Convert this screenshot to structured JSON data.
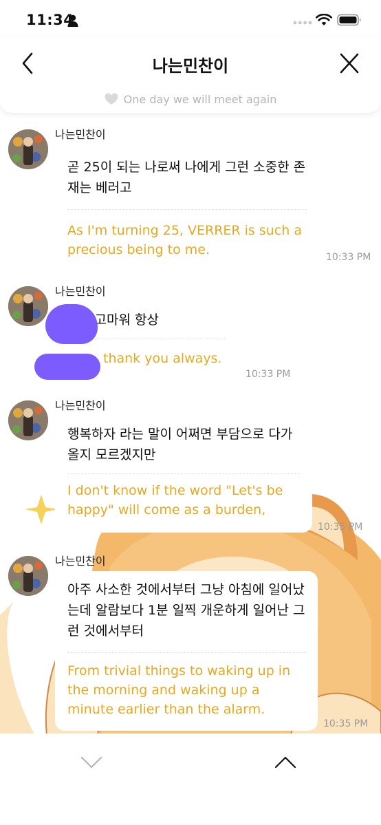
{
  "status_bar": {
    "time": "11:34"
  },
  "header": {
    "title": "나는민찬이",
    "subtitle": "One day we will meet again"
  },
  "messages": [
    {
      "sender": "나는민찬이",
      "original": "곧 25이 되는 나로써 나에게 그런 소중한 존재는 베러고",
      "translation": "As I'm turning 25, VERRER is such a precious being to me.",
      "time": "10:33 PM"
    },
    {
      "sender": "나는민찬이",
      "original": "야 고마워 항상",
      "translation": "thank you always.",
      "time": "10:33 PM"
    },
    {
      "sender": "나는민찬이",
      "original": "행복하자 라는 말이 어쩌면 부담으로 다가올지 모르겠지만",
      "translation": "I don't know if the word \"Let's be happy\" will come as a burden,",
      "time": "10:35 PM"
    },
    {
      "sender": "나는민찬이",
      "original": "아주 사소한 것에서부터 그냥 아침에 일어났는데 알람보다 1분 일찍 개운하게 일어난 그런 것에서부터",
      "translation": "From trivial things to waking up in the morning and waking up a minute earlier than the alarm.",
      "time": "10:35 PM"
    }
  ],
  "colors": {
    "translation_text": "#e8a81d",
    "subtitle_text": "#b5b5b5",
    "redaction": "#7d5cff"
  },
  "icons": {
    "back": "chevron-left-icon",
    "close": "close-icon",
    "subtitle": "heart-icon",
    "scroll_down": "chevron-down-icon",
    "scroll_up": "chevron-up-icon"
  }
}
